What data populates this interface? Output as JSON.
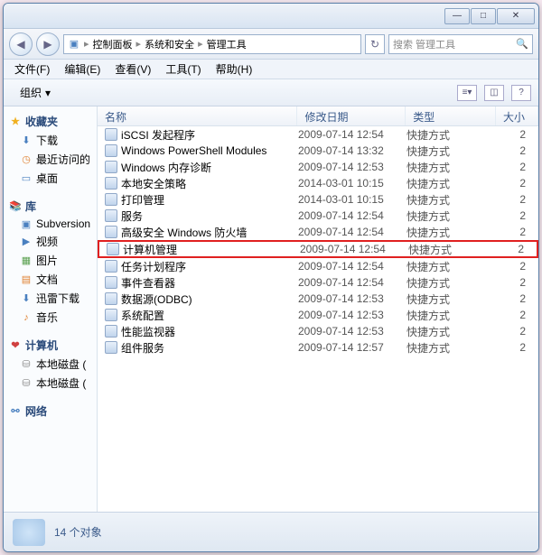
{
  "titlebar": {
    "min": "—",
    "max": "□",
    "close": "✕"
  },
  "nav": {
    "back": "◀",
    "fwd": "▶",
    "crumbs": [
      "控制面板",
      "系统和安全",
      "管理工具"
    ],
    "refresh": "↻",
    "search_placeholder": "搜索 管理工具",
    "search_icon": "🔍"
  },
  "menubar": [
    "文件(F)",
    "编辑(E)",
    "查看(V)",
    "工具(T)",
    "帮助(H)"
  ],
  "toolbar": {
    "organize": "组织",
    "chev": "▾",
    "help": "?"
  },
  "sidebar": {
    "fav": {
      "head": "收藏夹",
      "items": [
        "下载",
        "最近访问的",
        "桌面"
      ]
    },
    "lib": {
      "head": "库",
      "items": [
        "Subversion",
        "视频",
        "图片",
        "文档",
        "迅雷下载",
        "音乐"
      ]
    },
    "comp": {
      "head": "计算机",
      "items": [
        "本地磁盘 (",
        "本地磁盘 ("
      ]
    },
    "net": {
      "head": "网络"
    }
  },
  "columns": {
    "name": "名称",
    "date": "修改日期",
    "type": "类型",
    "size": "大小"
  },
  "files": [
    {
      "name": "iSCSI 发起程序",
      "date": "2009-07-14 12:54",
      "type": "快捷方式",
      "size": "2"
    },
    {
      "name": "Windows PowerShell Modules",
      "date": "2009-07-14 13:32",
      "type": "快捷方式",
      "size": "2"
    },
    {
      "name": "Windows 内存诊断",
      "date": "2009-07-14 12:53",
      "type": "快捷方式",
      "size": "2"
    },
    {
      "name": "本地安全策略",
      "date": "2014-03-01 10:15",
      "type": "快捷方式",
      "size": "2"
    },
    {
      "name": "打印管理",
      "date": "2014-03-01 10:15",
      "type": "快捷方式",
      "size": "2"
    },
    {
      "name": "服务",
      "date": "2009-07-14 12:54",
      "type": "快捷方式",
      "size": "2"
    },
    {
      "name": "高级安全 Windows 防火墙",
      "date": "2009-07-14 12:54",
      "type": "快捷方式",
      "size": "2"
    },
    {
      "name": "计算机管理",
      "date": "2009-07-14 12:54",
      "type": "快捷方式",
      "size": "2",
      "highlight": true
    },
    {
      "name": "任务计划程序",
      "date": "2009-07-14 12:54",
      "type": "快捷方式",
      "size": "2"
    },
    {
      "name": "事件查看器",
      "date": "2009-07-14 12:54",
      "type": "快捷方式",
      "size": "2"
    },
    {
      "name": "数据源(ODBC)",
      "date": "2009-07-14 12:53",
      "type": "快捷方式",
      "size": "2"
    },
    {
      "name": "系统配置",
      "date": "2009-07-14 12:53",
      "type": "快捷方式",
      "size": "2"
    },
    {
      "name": "性能监视器",
      "date": "2009-07-14 12:53",
      "type": "快捷方式",
      "size": "2"
    },
    {
      "name": "组件服务",
      "date": "2009-07-14 12:57",
      "type": "快捷方式",
      "size": "2"
    }
  ],
  "status": "14 个对象"
}
